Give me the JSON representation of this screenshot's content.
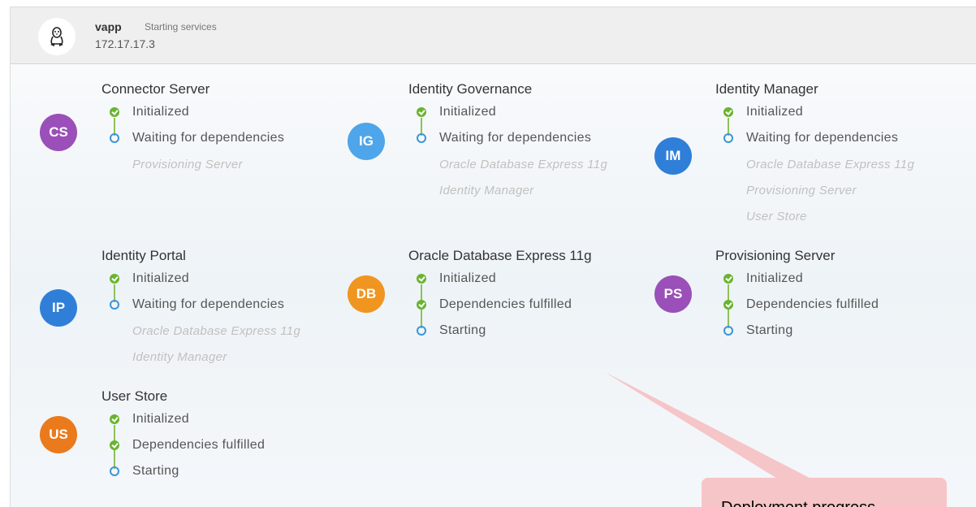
{
  "header": {
    "os_icon": "linux-penguin-icon",
    "name": "vapp",
    "status": "Starting services",
    "ip": "172.17.17.3"
  },
  "colors": {
    "purple": "#9b4fb8",
    "light_blue": "#4ea5ea",
    "blue": "#2f7fd9",
    "orange": "#f0951f",
    "deep_orange": "#ea7a1c",
    "check": "#6ab42f",
    "ring": "#3a95d8"
  },
  "services": {
    "cs": {
      "abbr": "CS",
      "title": "Connector Server",
      "steps": [
        "Initialized",
        "Waiting for dependencies"
      ],
      "deps": [
        "Provisioning Server"
      ]
    },
    "ig": {
      "abbr": "IG",
      "title": "Identity Governance",
      "steps": [
        "Initialized",
        "Waiting for dependencies"
      ],
      "deps": [
        "Oracle Database Express 11g",
        "Identity Manager"
      ]
    },
    "im": {
      "abbr": "IM",
      "title": "Identity Manager",
      "steps": [
        "Initialized",
        "Waiting for dependencies"
      ],
      "deps": [
        "Oracle Database Express 11g",
        "Provisioning Server",
        "User Store"
      ]
    },
    "ip": {
      "abbr": "IP",
      "title": "Identity Portal",
      "steps": [
        "Initialized",
        "Waiting for dependencies"
      ],
      "deps": [
        "Oracle Database Express 11g",
        "Identity Manager"
      ]
    },
    "db": {
      "abbr": "DB",
      "title": "Oracle Database Express 11g",
      "steps": [
        "Initialized",
        "Dependencies fulfilled",
        "Starting"
      ]
    },
    "ps": {
      "abbr": "PS",
      "title": "Provisioning Server",
      "steps": [
        "Initialized",
        "Dependencies fulfilled",
        "Starting"
      ]
    },
    "us": {
      "abbr": "US",
      "title": "User Store",
      "steps": [
        "Initialized",
        "Dependencies fulfilled",
        "Starting"
      ]
    }
  },
  "callout": {
    "text": "Deployment progress"
  }
}
